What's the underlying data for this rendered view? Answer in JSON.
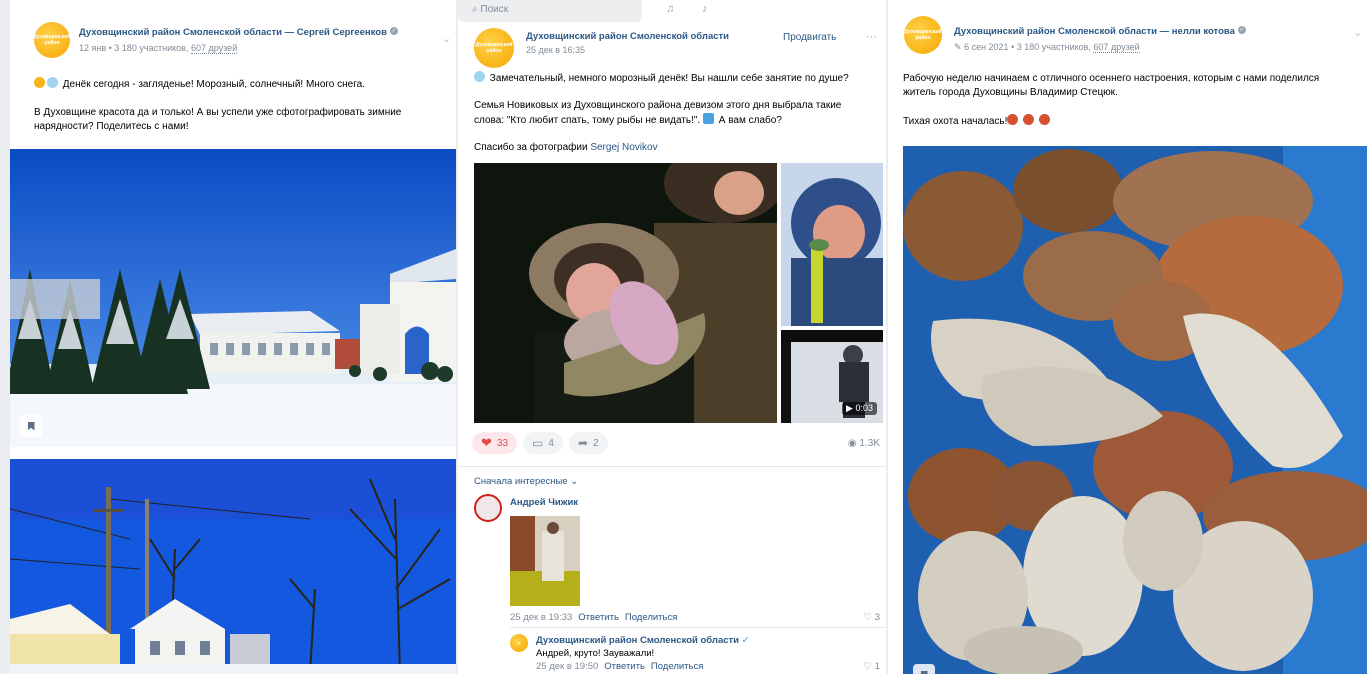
{
  "post1": {
    "author": "Духовщинский район Смоленской области — Сергей Сергеенков",
    "date": "12 янв",
    "participants": "3 180 участников,",
    "friends": "607 друзей",
    "line1": "Денёк сегодня - загляденье! Морозный, солнечный! Много снега.",
    "line2": "В Духовщине красота да и только! А вы успели уже сфотографировать зимние нарядности? Поделитесь с нами!"
  },
  "post2": {
    "search_placeholder": "Поиск",
    "author": "Духовщинский район Смоленской области",
    "date": "25 дек в 16:35",
    "promote": "Продвигать",
    "more": "···",
    "line1": "Замечательный, немного морозный денёк! Вы нашли себе занятие по душе?",
    "line2": "Семья Новиковых из Духовщинского района девизом этого дня выбрала такие слова: \"Кто любит спать, тому рыбы не видать!\".",
    "line2b": "А вам слабо?",
    "thanks": "Спасибо за фотографии",
    "thanks_link": "Sergej Novikov",
    "video_duration": "0:03",
    "likes": "33",
    "comments": "4",
    "shares": "2",
    "views": "1.3K",
    "sort": "Сначала интересные",
    "comment1": {
      "author": "Андрей Чижик",
      "date": "25 дек в 19:33",
      "reply": "Ответить",
      "share": "Поделиться",
      "likes": "3"
    },
    "comment2": {
      "author": "Духовщинский район Смоленской области",
      "text": "Андрей, круто! Зауважали!",
      "date": "25 дек в 19:50",
      "reply": "Ответить",
      "share": "Поделиться",
      "likes": "1"
    }
  },
  "post3": {
    "author": "Духовщинский район Смоленской области — нелли котова",
    "date": "6 сен 2021",
    "participants": "3 180 участников,",
    "friends": "607 друзей",
    "line1": "Рабочую неделю начинаем с отличного осеннего настроения, которым с нами поделился житель города Духовщины Владимир Стецюк.",
    "line2": "Тихая охота началась!"
  }
}
